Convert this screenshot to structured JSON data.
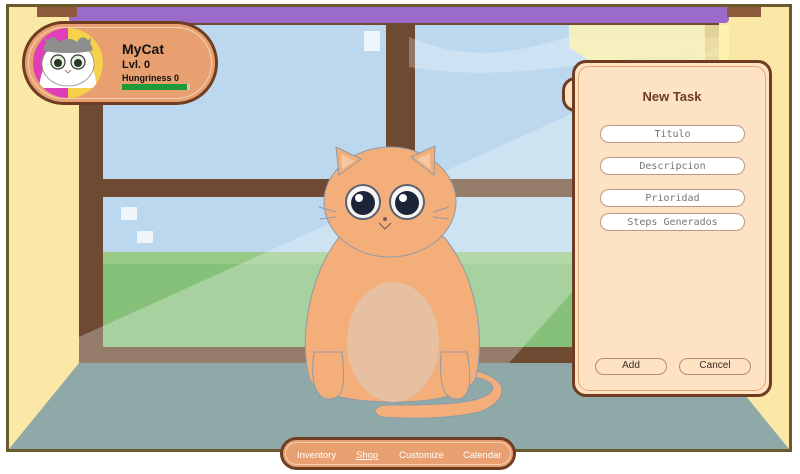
{
  "profile": {
    "name": "MyCat",
    "level": "Lvl. 0",
    "hunger_label": "Hungriness 0",
    "hunger_fraction": 0.95
  },
  "panel_toggle": {
    "label": ">"
  },
  "task_form": {
    "title": "New Task",
    "title_placeholder": "Titulo",
    "description_placeholder": "Descripcion",
    "priority_placeholder": "Prioridad",
    "steps_placeholder": "Steps Generados",
    "add_label": "Add",
    "cancel_label": "Cancel"
  },
  "nav": {
    "inventory": "Inventory",
    "shop": "Shop",
    "customize": "Customize",
    "calendar": "Calendar",
    "active": "shop"
  },
  "colors": {
    "frame": "#6b5a2e",
    "wall": "#fbe8a6",
    "curtain_rod": "#9a6bc8",
    "window_frame": "#6e4a33",
    "sky": "#bcd8ee",
    "grass": "#86c17a",
    "floor": "#8fa9a8",
    "cat_body": "#f4ae7a",
    "cat_belly": "#e6c0a0",
    "panel_bg": "#fde2c4",
    "accent_brown": "#6e3d22",
    "card_bg": "#e8a070",
    "hunger_bar": "#1f9a3a"
  }
}
